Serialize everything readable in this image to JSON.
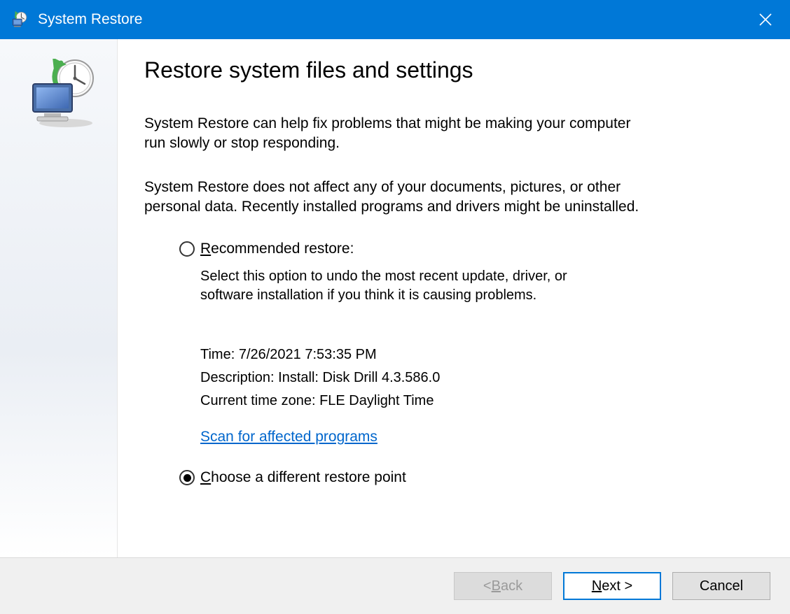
{
  "window": {
    "title": "System Restore"
  },
  "page": {
    "heading": "Restore system files and settings",
    "paragraph1": "System Restore can help fix problems that might be making your computer run slowly or stop responding.",
    "paragraph2": "System Restore does not affect any of your documents, pictures, or other personal data. Recently installed programs and drivers might be uninstalled."
  },
  "options": {
    "recommended": {
      "label_prefix": "R",
      "label_rest": "ecommended restore:",
      "description": "Select this option to undo the most recent update, driver, or software installation if you think it is causing problems.",
      "details": {
        "time": "Time: 7/26/2021 7:53:35 PM",
        "description": "Description: Install: Disk Drill 4.3.586.0",
        "timezone": "Current time zone: FLE Daylight Time"
      },
      "scan_link": "Scan for affected programs"
    },
    "different": {
      "label_prefix": "C",
      "label_rest": "hoose a different restore point"
    }
  },
  "footer": {
    "back_prefix": "< ",
    "back_ul": "B",
    "back_rest": "ack",
    "next_ul": "N",
    "next_rest": "ext >",
    "cancel": "Cancel"
  }
}
